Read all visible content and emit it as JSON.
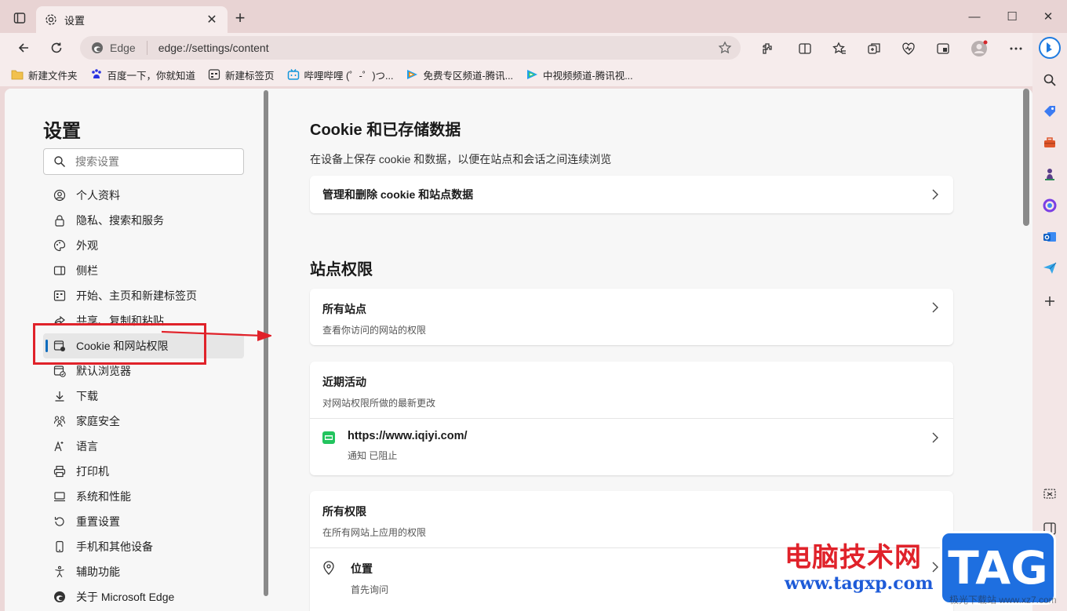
{
  "window": {
    "tab_title": "设置",
    "new_tab": "+",
    "minimize": "—",
    "maximize": "☐",
    "close": "✕"
  },
  "toolbar": {
    "address_chip": "Edge",
    "url": "edge://settings/content"
  },
  "favorites": [
    {
      "label": "新建文件夹",
      "icon": "folder-icon"
    },
    {
      "label": "百度一下，你就知道",
      "icon": "baidu-icon"
    },
    {
      "label": "新建标签页",
      "icon": "newtab-page-icon"
    },
    {
      "label": "哔哩哔哩 (゜-゜)つ...",
      "icon": "bilibili-icon"
    },
    {
      "label": "免费专区频道-腾讯...",
      "icon": "tencent-video-icon"
    },
    {
      "label": "中视频频道-腾讯视...",
      "icon": "tencent-video-icon"
    }
  ],
  "settings": {
    "title": "设置",
    "search_placeholder": "搜索设置",
    "nav": [
      {
        "label": "个人资料",
        "icon": "profile-icon"
      },
      {
        "label": "隐私、搜索和服务",
        "icon": "lock-icon"
      },
      {
        "label": "外观",
        "icon": "palette-icon"
      },
      {
        "label": "侧栏",
        "icon": "sidebar-icon"
      },
      {
        "label": "开始、主页和新建标签页",
        "icon": "home-grid-icon"
      },
      {
        "label": "共享、复制和粘贴",
        "icon": "share-icon"
      },
      {
        "label": "Cookie 和网站权限",
        "icon": "cookie-permissions-icon",
        "active": true
      },
      {
        "label": "默认浏览器",
        "icon": "default-browser-icon"
      },
      {
        "label": "下载",
        "icon": "download-icon"
      },
      {
        "label": "家庭安全",
        "icon": "family-icon"
      },
      {
        "label": "语言",
        "icon": "language-icon"
      },
      {
        "label": "打印机",
        "icon": "printer-icon"
      },
      {
        "label": "系统和性能",
        "icon": "system-icon"
      },
      {
        "label": "重置设置",
        "icon": "reset-icon"
      },
      {
        "label": "手机和其他设备",
        "icon": "phone-icon"
      },
      {
        "label": "辅助功能",
        "icon": "accessibility-icon"
      },
      {
        "label": "关于 Microsoft Edge",
        "icon": "edge-logo-icon"
      }
    ]
  },
  "content": {
    "cookie_section": {
      "title": "Cookie 和已存储数据",
      "desc": "在设备上保存 cookie 和数据，以便在站点和会话之间连续浏览",
      "manage_label": "管理和删除 cookie 和站点数据"
    },
    "permissions_section": {
      "title": "站点权限",
      "all_sites_title": "所有站点",
      "all_sites_sub": "查看你访问的网站的权限",
      "recent_title": "近期活动",
      "recent_sub": "对网站权限所做的最新更改",
      "recent_site": "https://www.iqiyi.com/",
      "recent_site_detail": "通知 已阻止",
      "all_perms_title": "所有权限",
      "all_perms_sub": "在所有网站上应用的权限",
      "location_title": "位置",
      "location_sub": "首先询问"
    }
  },
  "watermark": {
    "line1": "电脑技术网",
    "line2": "www.tagxp.com",
    "logo": "TAG",
    "sub": "极光下载站 www.xz7.com"
  },
  "colors": {
    "accent": "#0f6cbd",
    "annotation_red": "#e0222a",
    "watermark_blue": "#1e6fe0"
  }
}
